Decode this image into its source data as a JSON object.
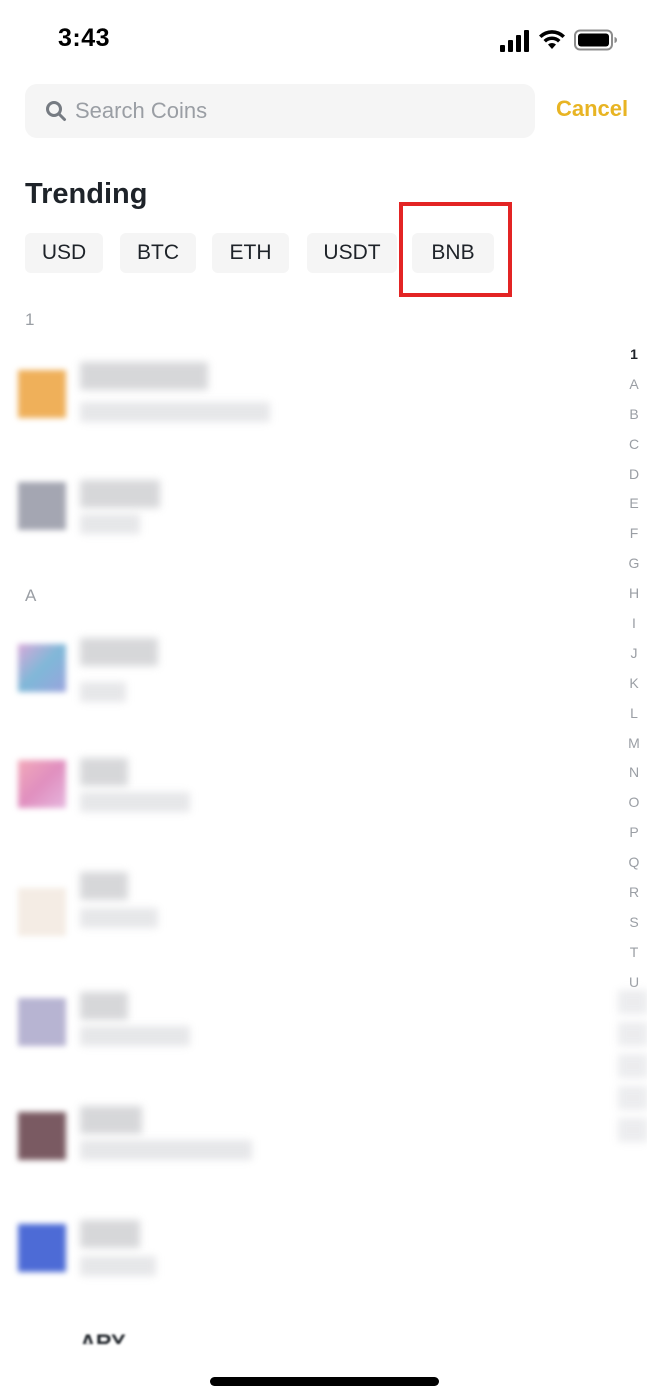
{
  "status_bar": {
    "time": "3:43"
  },
  "search": {
    "placeholder": "Search Coins",
    "value": "",
    "cancel_label": "Cancel"
  },
  "trending": {
    "title": "Trending",
    "chips": [
      "USD",
      "BTC",
      "ETH",
      "USDT",
      "BNB"
    ],
    "highlighted_chip": "BNB"
  },
  "sections": [
    {
      "header": "1",
      "rows": 2
    },
    {
      "header": "A",
      "rows": 6
    }
  ],
  "alphabet_index": [
    "1",
    "A",
    "B",
    "C",
    "D",
    "E",
    "F",
    "G",
    "H",
    "I",
    "J",
    "K",
    "L",
    "M",
    "N",
    "O",
    "P",
    "Q",
    "R",
    "S",
    "T",
    "U"
  ],
  "active_index": "1",
  "bottom_partial_text": "ARY",
  "colors": {
    "accent": "#e8b423",
    "highlight_box": "#e32424",
    "chip_bg": "#f5f5f5",
    "muted_text": "#9a9ea4"
  }
}
